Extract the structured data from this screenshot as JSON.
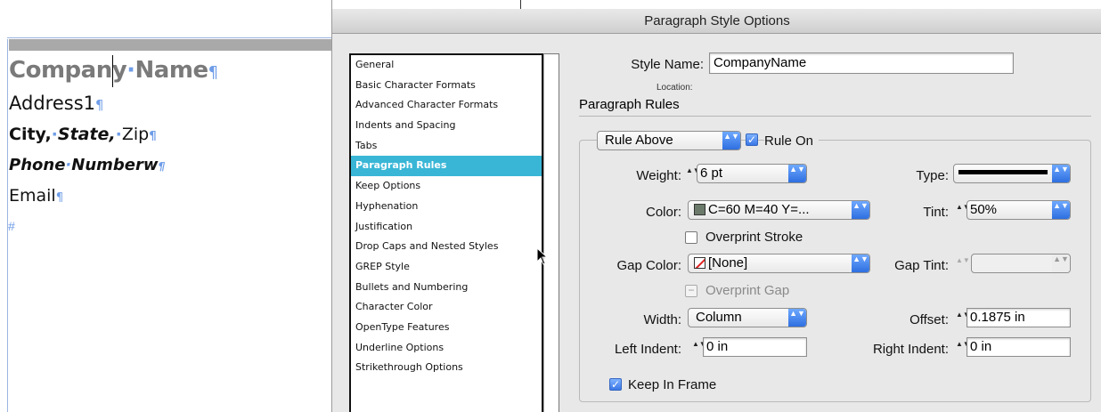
{
  "document": {
    "company_name": "Company",
    "company_name_2": "Name",
    "address": "Address1",
    "city": "City,",
    "state": "State,",
    "zip": "Zip",
    "phone_1": "Phone",
    "phone_2": "Numberw",
    "email": "Email",
    "pilcrow": "¶",
    "space_dot": "·",
    "end_marker": "#"
  },
  "dialog": {
    "title": "Paragraph Style Options",
    "background_title": "CompanyName",
    "categories": [
      "General",
      "Basic Character Formats",
      "Advanced Character Formats",
      "Indents and Spacing",
      "Tabs",
      "Paragraph Rules",
      "Keep Options",
      "Hyphenation",
      "Justification",
      "Drop Caps and Nested Styles",
      "GREP Style",
      "Bullets and Numbering",
      "Character Color",
      "OpenType Features",
      "Underline Options",
      "Strikethrough Options"
    ],
    "selected_category": "Paragraph Rules",
    "style_name_label": "Style Name:",
    "style_name_value": "CompanyName",
    "location_label": "Location:",
    "section_title": "Paragraph Rules",
    "rule_select": "Rule Above",
    "rule_on_label": "Rule On",
    "weight_label": "Weight:",
    "weight_value": "6 pt",
    "type_label": "Type:",
    "color_label": "Color:",
    "color_value": "C=60 M=40 Y=...",
    "tint_label": "Tint:",
    "tint_value": "50%",
    "overprint_stroke_label": "Overprint Stroke",
    "gap_color_label": "Gap Color:",
    "gap_color_value": "[None]",
    "gap_tint_label": "Gap Tint:",
    "overprint_gap_label": "Overprint Gap",
    "width_label": "Width:",
    "width_value": "Column",
    "offset_label": "Offset:",
    "offset_value": "0.1875 in",
    "left_indent_label": "Left Indent:",
    "left_indent_value": "0 in",
    "right_indent_label": "Right Indent:",
    "right_indent_value": "0 in",
    "keep_in_frame_label": "Keep In Frame",
    "stepper_glyph": "▲▼",
    "popup_glyph": "▲▼",
    "check_glyph": "✓",
    "mixed_glyph": "−"
  },
  "colors": {
    "selection": "#39b6d6",
    "accent_blue": "#3a78e6",
    "guide_blue": "#6f9de8"
  }
}
